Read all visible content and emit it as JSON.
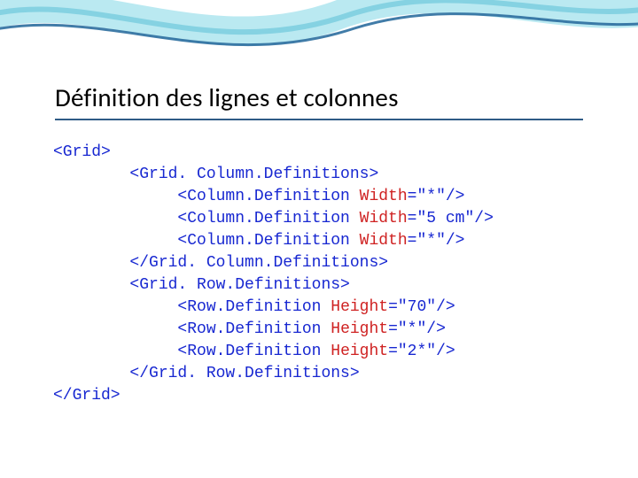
{
  "title": "Définition des lignes et colonnes",
  "code": {
    "l01": "<Grid>",
    "l02a": "        <Grid. Column.Definitions>",
    "l03a": "             <Column.Definition ",
    "l03b": "Width",
    "l03c": "=\"*\"/>",
    "l04a": "             <Column.Definition ",
    "l04b": "Width",
    "l04c": "=\"5 cm\"/>",
    "l05a": "             <Column.Definition ",
    "l05b": "Width",
    "l05c": "=\"*\"/>",
    "l06": "        </Grid. Column.Definitions>",
    "l07": "        <Grid. Row.Definitions>",
    "l08a": "             <Row.Definition ",
    "l08b": "Height",
    "l08c": "=\"70\"/>",
    "l09a": "             <Row.Definition ",
    "l09b": "Height",
    "l09c": "=\"*\"/>",
    "l10a": "             <Row.Definition ",
    "l10b": "Height",
    "l10c": "=\"2*\"/>",
    "l11": "        </Grid. Row.Definitions>",
    "l12": "</Grid>"
  },
  "colors": {
    "title_underline": "#2f5b86",
    "xml_tag": "#1727d1",
    "xml_attr": "#cf2222",
    "wave_light": "#aee5ef",
    "wave_dark": "#2c6e9e"
  }
}
